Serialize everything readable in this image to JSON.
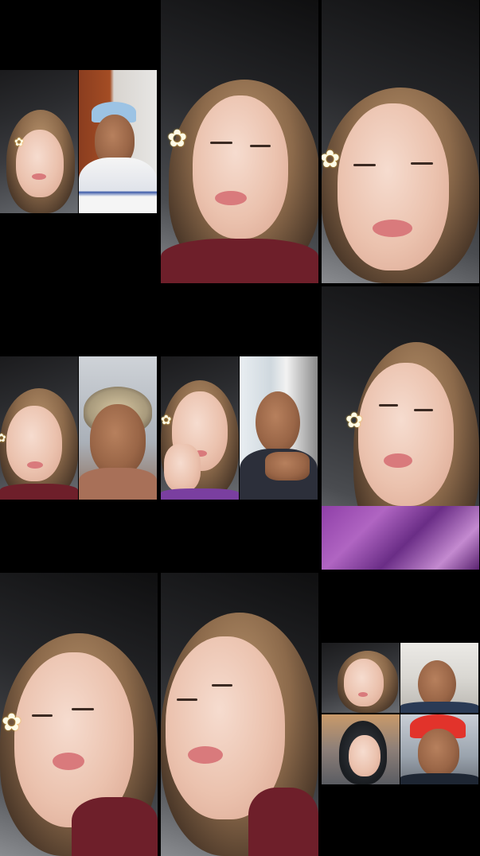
{
  "screen": {
    "background": "#000000",
    "columns": 3,
    "rows": 3
  },
  "tiles": [
    {
      "index": 0,
      "type": "duet",
      "participants": 2,
      "scenes": [
        "car-interior",
        "wooden-door"
      ]
    },
    {
      "index": 1,
      "type": "single",
      "participants": 1,
      "scenes": [
        "car-interior"
      ]
    },
    {
      "index": 2,
      "type": "single",
      "participants": 1,
      "scenes": [
        "car-interior"
      ]
    },
    {
      "index": 3,
      "type": "duet",
      "participants": 2,
      "scenes": [
        "car-interior",
        "indoor-room"
      ]
    },
    {
      "index": 4,
      "type": "duet",
      "participants": 2,
      "scenes": [
        "car-interior",
        "window-room"
      ]
    },
    {
      "index": 5,
      "type": "single",
      "participants": 1,
      "scenes": [
        "car-interior"
      ]
    },
    {
      "index": 6,
      "type": "single",
      "participants": 1,
      "scenes": [
        "car-interior"
      ]
    },
    {
      "index": 7,
      "type": "single",
      "participants": 1,
      "scenes": [
        "car-interior"
      ]
    },
    {
      "index": 8,
      "type": "quad",
      "participants": 4,
      "scenes": [
        "car-interior",
        "bright-room",
        "salon",
        "outdoor"
      ]
    }
  ],
  "icons": {
    "flower": "plumeria-flower-icon"
  }
}
